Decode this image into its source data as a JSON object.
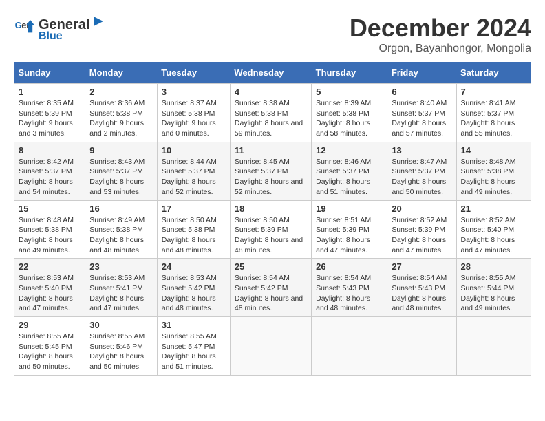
{
  "header": {
    "logo_line1": "General",
    "logo_line2": "Blue",
    "month_title": "December 2024",
    "location": "Orgon, Bayanhongor, Mongolia"
  },
  "weekdays": [
    "Sunday",
    "Monday",
    "Tuesday",
    "Wednesday",
    "Thursday",
    "Friday",
    "Saturday"
  ],
  "weeks": [
    [
      {
        "day": "1",
        "sunrise": "8:35 AM",
        "sunset": "5:39 PM",
        "daylight": "9 hours and 3 minutes."
      },
      {
        "day": "2",
        "sunrise": "8:36 AM",
        "sunset": "5:38 PM",
        "daylight": "9 hours and 2 minutes."
      },
      {
        "day": "3",
        "sunrise": "8:37 AM",
        "sunset": "5:38 PM",
        "daylight": "9 hours and 0 minutes."
      },
      {
        "day": "4",
        "sunrise": "8:38 AM",
        "sunset": "5:38 PM",
        "daylight": "8 hours and 59 minutes."
      },
      {
        "day": "5",
        "sunrise": "8:39 AM",
        "sunset": "5:38 PM",
        "daylight": "8 hours and 58 minutes."
      },
      {
        "day": "6",
        "sunrise": "8:40 AM",
        "sunset": "5:37 PM",
        "daylight": "8 hours and 57 minutes."
      },
      {
        "day": "7",
        "sunrise": "8:41 AM",
        "sunset": "5:37 PM",
        "daylight": "8 hours and 55 minutes."
      }
    ],
    [
      {
        "day": "8",
        "sunrise": "8:42 AM",
        "sunset": "5:37 PM",
        "daylight": "8 hours and 54 minutes."
      },
      {
        "day": "9",
        "sunrise": "8:43 AM",
        "sunset": "5:37 PM",
        "daylight": "8 hours and 53 minutes."
      },
      {
        "day": "10",
        "sunrise": "8:44 AM",
        "sunset": "5:37 PM",
        "daylight": "8 hours and 52 minutes."
      },
      {
        "day": "11",
        "sunrise": "8:45 AM",
        "sunset": "5:37 PM",
        "daylight": "8 hours and 52 minutes."
      },
      {
        "day": "12",
        "sunrise": "8:46 AM",
        "sunset": "5:37 PM",
        "daylight": "8 hours and 51 minutes."
      },
      {
        "day": "13",
        "sunrise": "8:47 AM",
        "sunset": "5:37 PM",
        "daylight": "8 hours and 50 minutes."
      },
      {
        "day": "14",
        "sunrise": "8:48 AM",
        "sunset": "5:38 PM",
        "daylight": "8 hours and 49 minutes."
      }
    ],
    [
      {
        "day": "15",
        "sunrise": "8:48 AM",
        "sunset": "5:38 PM",
        "daylight": "8 hours and 49 minutes."
      },
      {
        "day": "16",
        "sunrise": "8:49 AM",
        "sunset": "5:38 PM",
        "daylight": "8 hours and 48 minutes."
      },
      {
        "day": "17",
        "sunrise": "8:50 AM",
        "sunset": "5:38 PM",
        "daylight": "8 hours and 48 minutes."
      },
      {
        "day": "18",
        "sunrise": "8:50 AM",
        "sunset": "5:39 PM",
        "daylight": "8 hours and 48 minutes."
      },
      {
        "day": "19",
        "sunrise": "8:51 AM",
        "sunset": "5:39 PM",
        "daylight": "8 hours and 47 minutes."
      },
      {
        "day": "20",
        "sunrise": "8:52 AM",
        "sunset": "5:39 PM",
        "daylight": "8 hours and 47 minutes."
      },
      {
        "day": "21",
        "sunrise": "8:52 AM",
        "sunset": "5:40 PM",
        "daylight": "8 hours and 47 minutes."
      }
    ],
    [
      {
        "day": "22",
        "sunrise": "8:53 AM",
        "sunset": "5:40 PM",
        "daylight": "8 hours and 47 minutes."
      },
      {
        "day": "23",
        "sunrise": "8:53 AM",
        "sunset": "5:41 PM",
        "daylight": "8 hours and 47 minutes."
      },
      {
        "day": "24",
        "sunrise": "8:53 AM",
        "sunset": "5:42 PM",
        "daylight": "8 hours and 48 minutes."
      },
      {
        "day": "25",
        "sunrise": "8:54 AM",
        "sunset": "5:42 PM",
        "daylight": "8 hours and 48 minutes."
      },
      {
        "day": "26",
        "sunrise": "8:54 AM",
        "sunset": "5:43 PM",
        "daylight": "8 hours and 48 minutes."
      },
      {
        "day": "27",
        "sunrise": "8:54 AM",
        "sunset": "5:43 PM",
        "daylight": "8 hours and 48 minutes."
      },
      {
        "day": "28",
        "sunrise": "8:55 AM",
        "sunset": "5:44 PM",
        "daylight": "8 hours and 49 minutes."
      }
    ],
    [
      {
        "day": "29",
        "sunrise": "8:55 AM",
        "sunset": "5:45 PM",
        "daylight": "8 hours and 50 minutes."
      },
      {
        "day": "30",
        "sunrise": "8:55 AM",
        "sunset": "5:46 PM",
        "daylight": "8 hours and 50 minutes."
      },
      {
        "day": "31",
        "sunrise": "8:55 AM",
        "sunset": "5:47 PM",
        "daylight": "8 hours and 51 minutes."
      },
      null,
      null,
      null,
      null
    ]
  ]
}
